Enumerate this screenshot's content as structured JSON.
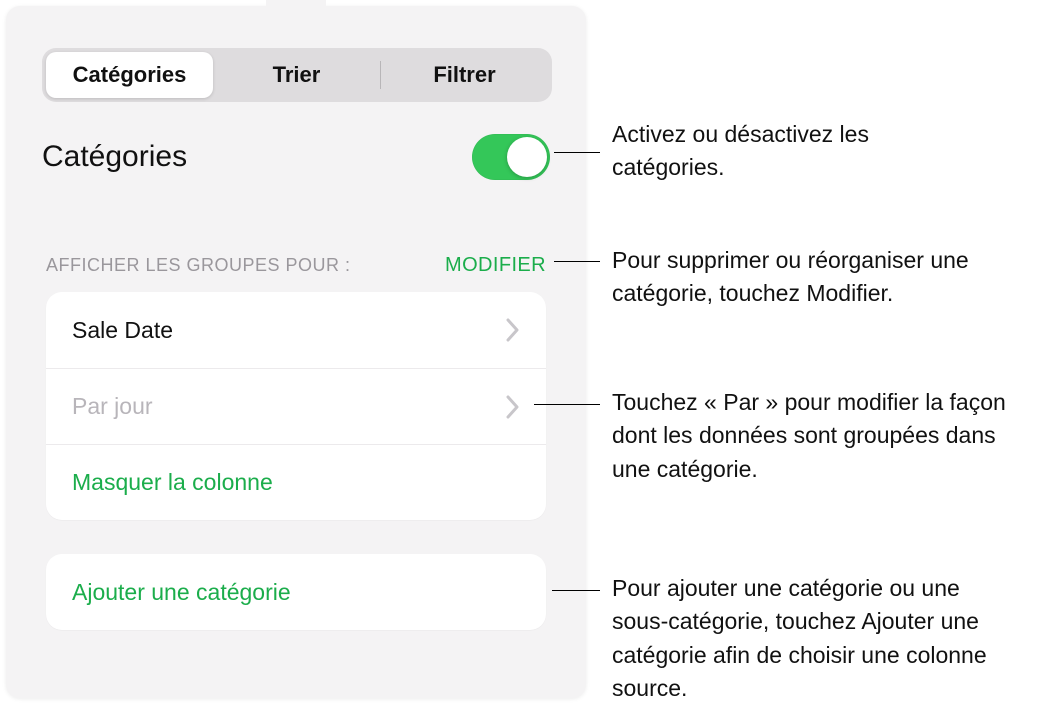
{
  "tabs": {
    "categories": "Catégories",
    "sort": "Trier",
    "filter": "Filtrer"
  },
  "section_title": "Catégories",
  "groups_label": "AFFICHER LES GROUPES POUR :",
  "edit_button": "MODIFIER",
  "rows": {
    "sale_date": "Sale Date",
    "by_day": "Par jour",
    "hide_column": "Masquer la colonne",
    "add_category": "Ajouter une catégorie"
  },
  "callouts": {
    "toggle": "Activez ou désactivez les catégories.",
    "edit": "Pour supprimer ou réorganiser une catégorie, touchez Modifier.",
    "by": "Touchez « Par » pour modifier la façon dont les données sont groupées dans une catégorie.",
    "add": "Pour ajouter une catégorie ou une sous-catégorie, touchez Ajouter une catégorie afin de choisir une colonne source."
  }
}
